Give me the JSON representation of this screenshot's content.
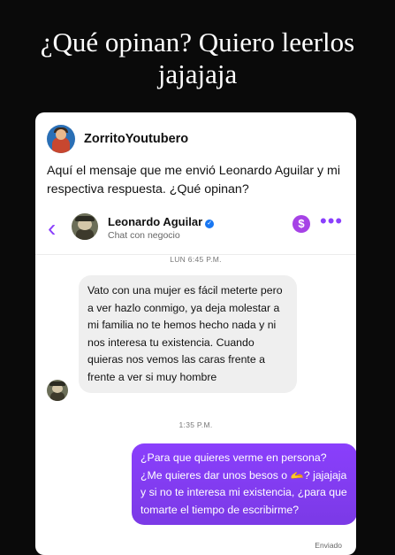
{
  "caption": {
    "line1": "¿Qué opinan? Quiero leerlos",
    "line2": "jajajaja"
  },
  "post": {
    "username": "ZorritoYoutubero",
    "text": "Aquí el mensaje que me envió Leonardo Aguilar y mi respectiva respuesta. ¿Qué opinan?"
  },
  "chat": {
    "contact_name": "Leonardo Aguilar",
    "contact_subtitle": "Chat con negocio",
    "back_icon": "‹",
    "payment_icon": "$",
    "more_icon": "•••",
    "verified_icon": "✓",
    "messages": [
      {
        "time": "LUN 6:45 P.M.",
        "text": "Vato con una mujer es fácil meterte pero a ver hazlo conmigo, ya deja molestar a mi familia no te hemos hecho nada y ni nos interesa tu existencia. Cuando quieras nos vemos las caras frente a frente a ver si muy hombre"
      },
      {
        "time": "1:35 P.M.",
        "text": "¿Para que quieres verme en persona? ¿Me quieres dar unos besos o 🫴? jajajaja y si no te interesa mi existencia, ¿para que tomarte el tiempo de escribirme?",
        "status": "Enviado"
      }
    ]
  },
  "colors": {
    "accent": "#8a3ffc",
    "verified": "#1877f2",
    "incoming_bubble": "#efefef"
  }
}
